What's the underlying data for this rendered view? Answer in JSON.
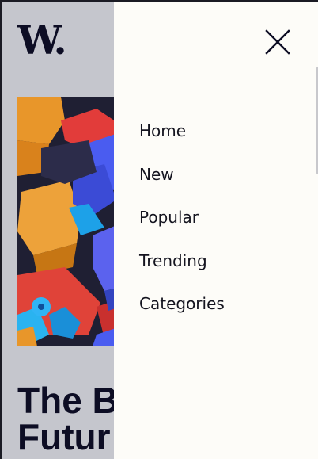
{
  "app": {
    "logo": "W."
  },
  "hero": {
    "headline_line1": "The B",
    "headline_line2": "Futur"
  },
  "menu": {
    "close_icon": "close-icon",
    "items": [
      {
        "label": "Home"
      },
      {
        "label": "New"
      },
      {
        "label": "Popular"
      },
      {
        "label": "Trending"
      },
      {
        "label": "Categories"
      }
    ]
  },
  "colors": {
    "page_background": "#c5c6cd",
    "drawer_background": "#fdfcf8",
    "text_dark": "#0d0d24"
  }
}
